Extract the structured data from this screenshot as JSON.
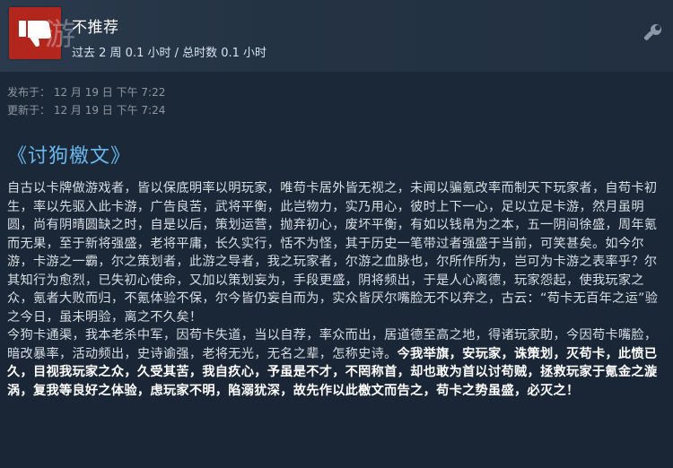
{
  "review": {
    "verdict": "不推荐",
    "hours": "过去 2 周 0.1 小时 / 总时数 0.1 小时",
    "posted": "发布于： 12 月 19 日 下午 7:22",
    "updated": "更新于： 12 月 19 日 下午 7:24",
    "title": "《讨狗檄文》",
    "body_normal_1": "自古以卡牌做游戏者，皆以保底明率以明玩家，唯苟卡居外皆无视之，未闻以骗氪改率而制天下玩家者，自苟卡初生，率以先驱入此卡游，广告良苦，武将平衡，此岂物力，实乃用心，彼时上下一心，足以立足卡游，然月虽明圆，尚有阴晴圆缺之时，自是以后，策划运营，抛弃初心，废坏平衡，有如以钱帛为之本，五一阴间徐盛，周年氪而无果，至于新将强盛，老将平庸，长久实行，恬不为怪，其于历史一笔带过者强盛于当前，可笑甚矣。如今尔游，卡游之一霸，尔之策划者，此游之导者，我之玩家者，尔游之血脉也，尔所作所为，岂可为卡游之表率乎？尔其知行为愈烈，已失初心使命，又加以策划妄为，手段更盛，阴将频出，于是人心离德，玩家怨起，使我玩家之众，氪者大败而归，不氪体验不保，尔今皆仍妄自而为，实众皆厌尔嘴脸无不以弃之，古云：“苟卡无百年之运”验之今日，虽未明验，离之不久矣！",
    "body_normal_2": "今狗卡通渠，我本老杀中军，因苟卡失道，当以自荐，率众而出，居道德至高之地，得诸玩家助，今因苟卡嘴脸，暗改暴率，活动频出，史诗谕强，老将无光，无名之辈，怎称史诗。",
    "body_bold": "今我举旗，安玩家，诛策划，灭苟卡，此愤已久，目视我玩家之众，久受其苦，我自疚心，予虽是不才，不罔称首，却也敢为首以讨苟贼，拯救玩家于氪金之漩涡，复我等良好之体验，虑玩家不明，陷溺犹深，故先作以此檄文而告之，苟卡之势虽盛，必灭之！"
  },
  "icons": {
    "thumb": "thumbs-down-icon",
    "settings": "wrench-icon"
  },
  "colors": {
    "background": "#1b2838",
    "thumb_bg": "#b3261e",
    "title": "#6ab7ec",
    "meta": "#8f98a0"
  }
}
